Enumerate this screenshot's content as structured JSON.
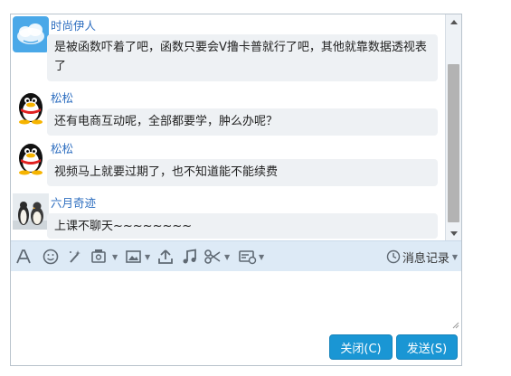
{
  "messages": [
    {
      "sender": "时尚伊人",
      "avatar": "blue-cloud-avatar",
      "text": "是被函数吓着了吧，函数只要会V撸卡普就行了吧，其他就靠数据透视表了"
    },
    {
      "sender": "松松",
      "avatar": "qq-penguin-avatar",
      "text": "还有电商互动呢，全部都要学，肿么办呢？"
    },
    {
      "sender": "松松",
      "avatar": "qq-penguin-avatar",
      "text": "视频马上就要过期了，也不知道能不能续费"
    },
    {
      "sender": "六月奇迹",
      "avatar": "penguins-photo-avatar",
      "text": "上课不聊天~~~~~~~~"
    }
  ],
  "toolbar": {
    "icons": [
      "font-icon",
      "emoji-icon",
      "magic-wand-icon",
      "screenshot-icon",
      "image-icon",
      "upload-icon",
      "music-icon",
      "scissors-icon",
      "card-icon"
    ],
    "history_label": "消息记录"
  },
  "buttons": {
    "close_label": "关闭(C)",
    "send_label": "发送(S)"
  },
  "colors": {
    "sender_name": "#2f6fc0",
    "bubble_bg": "#eef1f4",
    "toolbar_bg": "#ddeaf6",
    "button_bg": "#1a96d4"
  }
}
